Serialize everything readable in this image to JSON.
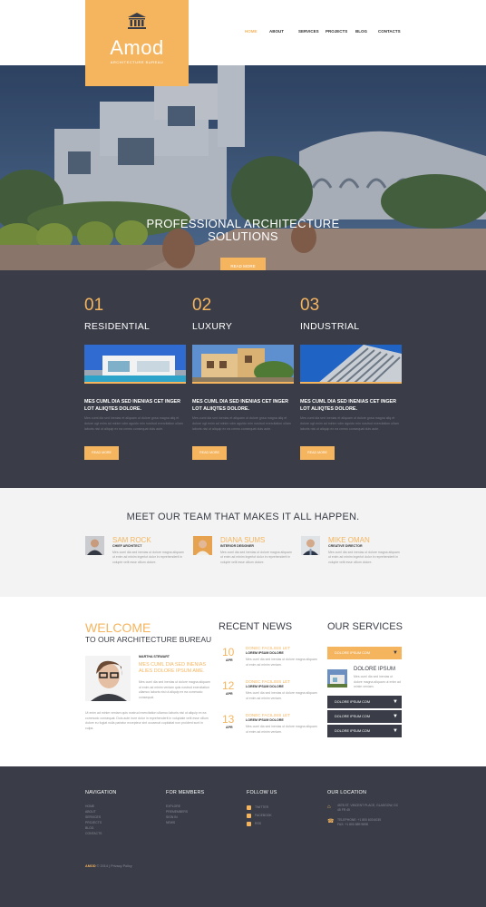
{
  "brand": {
    "name": "Amod",
    "tagline": "ARCHITECTURE BUREAU",
    "logo_icon": "bank-icon"
  },
  "nav": {
    "items": [
      "HOME",
      "ABOUT",
      "SERVICES",
      "PROJECTS",
      "BLOG",
      "CONTACTS"
    ],
    "active": "HOME"
  },
  "hero": {
    "title_line1": "PROFESSIONAL ARCHITECTURE",
    "title_line2": "SOLUTIONS",
    "button": "READ MORE"
  },
  "features": [
    {
      "num": "01",
      "title": "RESIDENTIAL",
      "sub": "MES CUML DIA SED INENIAS CET INGER LOT ALIIQTES DOLORE.",
      "text": "Mes cuml dia sed inenias et aliquam ut dolore gnsa magna aliq et dolore ugt enim ad minim vdm aguido rnin nostrud exercitation ullam laboris nisi ut aliquip ex ea cmmo consequat duis aute.",
      "button": "READ MORE"
    },
    {
      "num": "02",
      "title": "LUXURY",
      "sub": "MES CUML DIA SED INENIAS CET INGER LOT ALIIQTES DOLORE.",
      "text": "Mes cuml dia sed inenias et aliquam ut dolore gnsa magna aliq et dolore ugt enim ad minim vdm aguido rnin nostrud exercitation ullam laboris nisi ut aliquip ex ea cmmo consequat duis aute.",
      "button": "READ MORE"
    },
    {
      "num": "03",
      "title": "INDUSTRIAL",
      "sub": "MES CUML DIA SED INENIAS CET INGER LOT ALIIQTES DOLORE.",
      "text": "Mes cuml dia sed inenias et aliquam ut dolore gnsa magna aliq et dolore ugt enim ad minim vdm aguido rnin nostrud exercitation ullam laboris nisi ut aliquip ex ea cmmo consequat duis aute.",
      "button": "READ MORE"
    }
  ],
  "team": {
    "title": "MEET OUR TEAM THAT MAKES IT ALL HAPPEN.",
    "members": [
      {
        "name": "SAM ROCK",
        "role": "CHIEF ARCHITECT",
        "text": "Mes cuml dia sed inenias ut dolore magna aliquam ut enim ad minim ingerlot dolor in reprehenderit in volupte velit esse cillum dolore."
      },
      {
        "name": "DIANA SUMS",
        "role": "INTERIOR DESIGNER",
        "text": "Mes cuml dia sed inenias ut dolore magna aliquam ut enim ad minim ingerlot dolor in reprehenderit in volupte velit esse cillum dolore."
      },
      {
        "name": "MIKE OMAN",
        "role": "CREATIVE DIRECTOR",
        "text": "Mes cuml dia sed inenias ut dolore magna aliquam ut enim ad minim ingerlot dolor in reprehenderit in volupte velit esse cillum dolore."
      }
    ]
  },
  "welcome": {
    "title": "WELCOME",
    "subtitle": "TO OUR ARCHITECTURE BUREAU",
    "author": "MARTHA STEWART",
    "quote": "MES CUML DIA SED INENIAS ALIES DOLORE IPSUM AME.",
    "text1": "Mes cuml dia sed inenias ut dolore magna aliquam ut enim ad minim veniam quis nostrud exercitation ullamco laboris nisi ut aliquip ex ea commodo consequat.",
    "text2": "Ut enim ad minim veniam quis nostrud exercitation ullamco laboris nisi ut aliquip ex ea commodo consequat. Duis aute irure dolor in reprehenderit in voluptate velit esse cillum dolore eu fugiat nulla pariatur excepteur sint occaecat cupidatat non proident sunt in culpa."
  },
  "news": {
    "title": "RECENT NEWS",
    "items": [
      {
        "day": "10",
        "month": "APR",
        "heading": "DONEC FACILISIS LET",
        "sub": "LOREM IPSUM DOLORE",
        "text": "Mes cuml dia sed inenias ut dolore magna aliquam ut enim ad minim veniam."
      },
      {
        "day": "12",
        "month": "APR",
        "heading": "DONEC FACILISIS LET",
        "sub": "LOREM IPSUM DOLORE",
        "text": "Mes cuml dia sed inenias ut dolore magna aliquam ut enim ad minim veniam."
      },
      {
        "day": "13",
        "month": "APR",
        "heading": "DONEC FACILISIS LET",
        "sub": "LOREM IPSUM DOLORE",
        "text": "Mes cuml dia sed inenias ut dolore magna aliquam ut enim ad minim veniam."
      }
    ]
  },
  "services": {
    "title": "OUR SERVICES",
    "open_item": "DOLORE IPSUM COM",
    "open_heading": "DOLORE IPSUM",
    "open_text": "Mes cuml dia sed inenias ut dolore magna aliquam ut enim ad minim veniam.",
    "items": [
      "DOLORE IPSUM COM",
      "DOLORE IPSUM COM",
      "DOLORE IPSUM COM",
      "DOLORE IPSUM COM"
    ]
  },
  "footer": {
    "nav_title": "NAVIGATION",
    "nav_items": [
      "HOME",
      "ABOUT",
      "SERVICES",
      "PROJECTS",
      "BLOG",
      "CONTACTS"
    ],
    "members_title": "FOR MEMBERS",
    "members_items": [
      "EXPLORE",
      "PREMEMBERS",
      "SIGN IN",
      "NEWS"
    ],
    "follow_title": "FOLLOW US",
    "follow_items": [
      "TWITTER",
      "FACEBOOK",
      "RSS"
    ],
    "location_title": "OUR LOCATION",
    "address": "4578 ST. VINCENT PLACE, GLASGOW, DC 45 FR 45",
    "phone": "TELEPHONE: +1 800 603 6035",
    "fax": "FAX: +1 800 889 9898",
    "copyright_brand": "AMOD",
    "copyright_rest": "© 2014 | Privacy Policy"
  },
  "colors": {
    "accent": "#f5b55f",
    "dark": "#3a3d47",
    "light": "#f2f3f2"
  }
}
